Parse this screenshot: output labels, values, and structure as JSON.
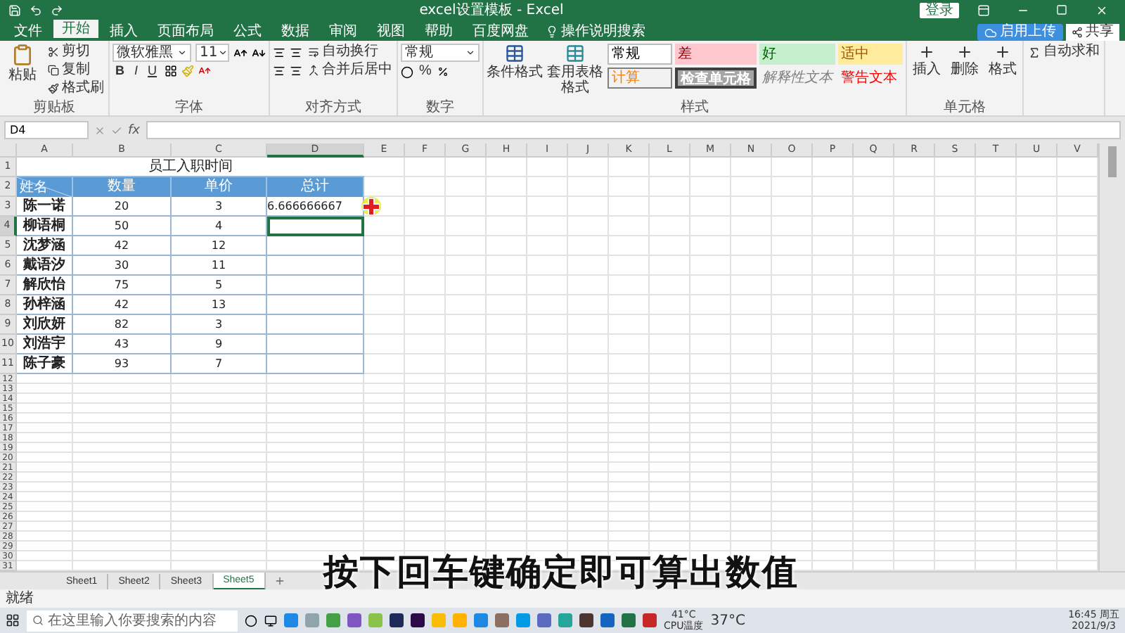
{
  "window": {
    "title": "excel设置模板 - Excel",
    "login": "登录",
    "upload": "启用上传"
  },
  "ribbon_tabs": [
    {
      "label": "文件",
      "selected": false
    },
    {
      "label": "开始",
      "selected": true
    },
    {
      "label": "插入",
      "selected": false
    },
    {
      "label": "页面布局",
      "selected": false
    },
    {
      "label": "公式",
      "selected": false
    },
    {
      "label": "数据",
      "selected": false
    },
    {
      "label": "审阅",
      "selected": false
    },
    {
      "label": "视图",
      "selected": false
    },
    {
      "label": "帮助",
      "selected": false
    },
    {
      "label": "百度网盘",
      "selected": false
    }
  ],
  "tell_me": "操作说明搜索",
  "share": "共享",
  "ribbon": {
    "clipboard": {
      "label": "剪贴板",
      "paste": "粘贴",
      "cut": "剪切",
      "copy": "复制",
      "format_painter": "格式刷"
    },
    "font": {
      "label": "字体",
      "font_name": "微软雅黑",
      "font_size": "11",
      "bold": "B",
      "italic": "I",
      "underline": "U"
    },
    "alignment": {
      "label": "对齐方式",
      "wrap": "自动换行",
      "merge": "合并后居中"
    },
    "number": {
      "label": "数字",
      "format": "常规",
      "percent": "%"
    },
    "styles": {
      "label": "样式",
      "conditional": "条件格式",
      "table": "套用表格格式",
      "gallery": [
        {
          "label": "常规",
          "kind": "normal"
        },
        {
          "label": "差",
          "kind": "bad"
        },
        {
          "label": "好",
          "kind": "good"
        },
        {
          "label": "适中",
          "kind": "neutral"
        },
        {
          "label": "计算",
          "kind": "calc"
        },
        {
          "label": "检查单元格",
          "kind": "check"
        },
        {
          "label": "解释性文本",
          "kind": "explanatory"
        },
        {
          "label": "警告文本",
          "kind": "warning"
        }
      ]
    },
    "cells": {
      "label": "单元格",
      "buttons": [
        "插入",
        "删除",
        "格式"
      ]
    },
    "editing": {
      "autosum": "自动求和"
    }
  },
  "formula_bar": {
    "name_box": "D4",
    "function_label": "fx"
  },
  "sheet": {
    "columns": [
      "A",
      "B",
      "C",
      "D",
      "E",
      "F",
      "G",
      "H",
      "I",
      "J",
      "K",
      "L",
      "M",
      "N",
      "O",
      "P",
      "Q",
      "R",
      "S",
      "T",
      "U",
      "V"
    ],
    "row_numbers": [
      "1",
      "2",
      "3",
      "4",
      "5",
      "6",
      "7",
      "8",
      "9",
      "10",
      "11",
      "12",
      "13",
      "14",
      "15",
      "16",
      "17",
      "18",
      "19",
      "20",
      "21",
      "22",
      "23",
      "24",
      "25",
      "26",
      "27",
      "28",
      "29",
      "30",
      "31"
    ],
    "title": "员工入职时间",
    "headers": {
      "name": "姓名",
      "quantity": "数量",
      "price": "单价",
      "total": "总计"
    },
    "rows": [
      {
        "name": "陈一诺",
        "quantity": "20",
        "price": "3",
        "total": "6.666666667",
        "total_selected": false
      },
      {
        "name": "柳语桐",
        "quantity": "50",
        "price": "4",
        "total_selected": true
      },
      {
        "name": "沈梦涵",
        "quantity": "42",
        "price": "12",
        "total_selected": false
      },
      {
        "name": "戴语汐",
        "quantity": "30",
        "price": "11",
        "total_selected": false
      },
      {
        "name": "解欣怡",
        "quantity": "75",
        "price": "5",
        "total_selected": false
      },
      {
        "name": "孙梓涵",
        "quantity": "42",
        "price": "13",
        "total_selected": false
      },
      {
        "name": "刘欣妍",
        "quantity": "82",
        "price": "3",
        "total_selected": false
      },
      {
        "name": "刘浩宇",
        "quantity": "43",
        "price": "9",
        "total_selected": false
      },
      {
        "name": "陈子豪",
        "quantity": "93",
        "price": "7",
        "total_selected": false
      }
    ]
  },
  "sheet_tabs": [
    {
      "label": "Sheet1",
      "selected": false
    },
    {
      "label": "Sheet2",
      "selected": false
    },
    {
      "label": "Sheet3",
      "selected": false
    },
    {
      "label": "Sheet5",
      "selected": true
    }
  ],
  "status_bar": {
    "text": "就绪"
  },
  "caption": "按下回车键确定即可算出数值",
  "taskbar": {
    "search_placeholder": "在这里输入你要搜索的内容",
    "cpu_temp": "41°C",
    "cpu_label": "CPU温度",
    "weather": "37°C",
    "time": "16:45 周五",
    "date": "2021/9/3"
  }
}
